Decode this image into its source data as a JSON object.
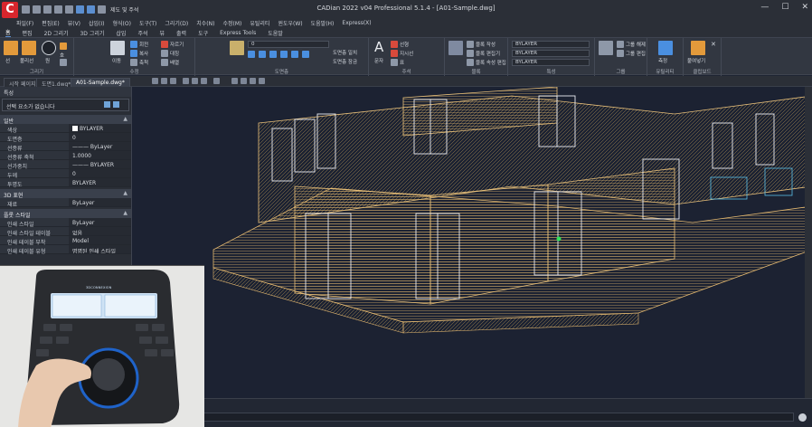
{
  "app": {
    "logo_letter": "C",
    "title": "CADian 2022 v04 Professional 5.1.4 - [A01-Sample.dwg]",
    "quick_access_label": "제도 및 주석",
    "window_controls": [
      "—",
      "☐",
      "✕"
    ]
  },
  "menu": [
    "파일(F)",
    "편집(E)",
    "뷰(V)",
    "삽입(I)",
    "형식(O)",
    "도구(T)",
    "그리기(D)",
    "치수(N)",
    "수정(M)",
    "유틸리티",
    "윈도우(W)",
    "도움말(H)",
    "Express(X)"
  ],
  "ribbon_tabs": [
    "홈",
    "편집",
    "2D 그리기",
    "3D 그리기",
    "삽입",
    "주석",
    "뷰",
    "출력",
    "도구",
    "Express Tools",
    "도움말"
  ],
  "ribbon": {
    "draw_panel": {
      "title": "그리기",
      "items": [
        "선",
        "폴리선",
        "원",
        "호",
        "사각형",
        "해치"
      ]
    },
    "modify_panel": {
      "title": "수정",
      "items": [
        "이동",
        "회전",
        "자르기",
        "복사",
        "대칭",
        "모깎기",
        "축척",
        "배열",
        "늘리기",
        "신축"
      ]
    },
    "layer_panel": {
      "title": "도면층",
      "layer_name": "0",
      "items": [
        "도면층 특성",
        "도면층 일치",
        "도면층 잠금"
      ]
    },
    "annotation_panel": {
      "title": "주석",
      "items": [
        "문자",
        "선형",
        "지시선",
        "표"
      ]
    },
    "block_panel": {
      "title": "블록",
      "items": [
        "블록 작성",
        "블록 편집기",
        "블록 속성 편집"
      ]
    },
    "properties_panel": {
      "title": "특성",
      "color": "BYLAYER",
      "linetype": "BYLAYER",
      "lineweight": "BYLAYER"
    },
    "group_panel": {
      "title": "그룹",
      "items": [
        "그룹",
        "그룹 해제",
        "그룹 편집"
      ]
    },
    "utility_panel": {
      "title": "유틸리티",
      "items": [
        "측정"
      ]
    },
    "clipboard_panel": {
      "title": "클립보드",
      "items": [
        "붙여넣기"
      ]
    }
  },
  "doc_tabs": [
    "시작 페이지",
    "도면1.dwg*",
    "A01-Sample.dwg*"
  ],
  "properties": {
    "title": "특성",
    "selection": "선택 요소가 없습니다",
    "sections": [
      {
        "name": "일반",
        "rows": [
          {
            "k": "색상",
            "v": "BYLAYER"
          },
          {
            "k": "도면층",
            "v": "0"
          },
          {
            "k": "선종류",
            "v": "——— ByLayer"
          },
          {
            "k": "선종류 축척",
            "v": "1.0000"
          },
          {
            "k": "선가중치",
            "v": "——— BYLAYER"
          },
          {
            "k": "두께",
            "v": "0"
          },
          {
            "k": "투명도",
            "v": "BYLAYER"
          }
        ]
      },
      {
        "name": "3D 표현",
        "rows": [
          {
            "k": "재료",
            "v": "ByLayer"
          }
        ]
      },
      {
        "name": "플롯 스타일",
        "rows": [
          {
            "k": "인쇄 스타일",
            "v": "ByLayer"
          },
          {
            "k": "인쇄 스타일 테이블",
            "v": "없음"
          },
          {
            "k": "인쇄 테이블 부착",
            "v": "Model"
          },
          {
            "k": "인쇄 테이블 유형",
            "v": "명명된 인쇄 스타일"
          }
        ]
      }
    ]
  },
  "webcam": {
    "device_label": "3DCONNEXION"
  }
}
